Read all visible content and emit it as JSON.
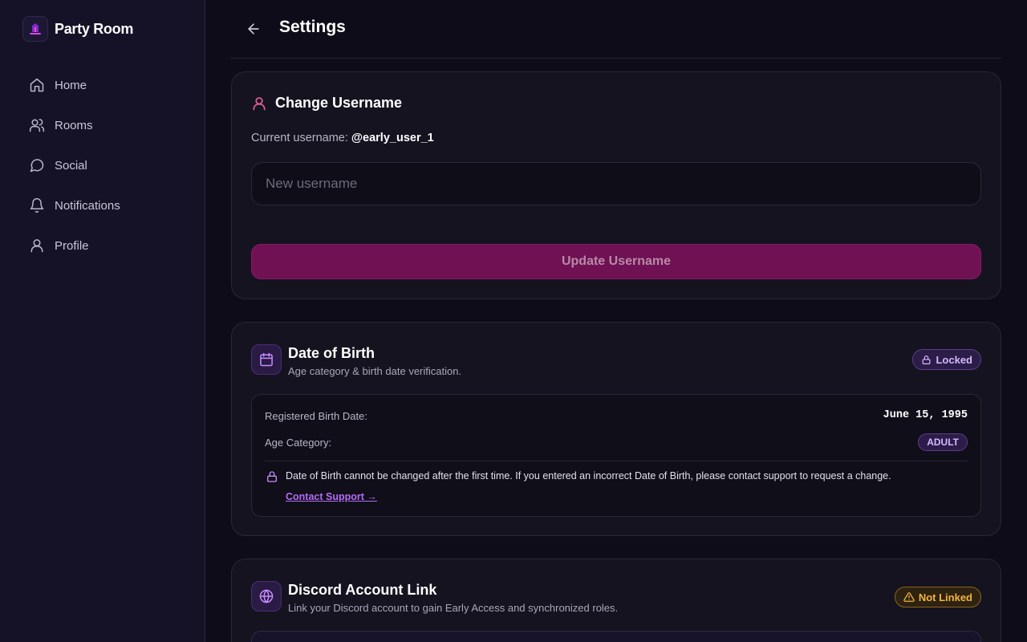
{
  "app": {
    "name": "Party Room"
  },
  "sidebar": {
    "items": [
      {
        "label": "Home",
        "icon": "home-icon"
      },
      {
        "label": "Rooms",
        "icon": "users-icon"
      },
      {
        "label": "Social",
        "icon": "chat-bubble-icon"
      },
      {
        "label": "Notifications",
        "icon": "bell-icon"
      },
      {
        "label": "Profile",
        "icon": "user-icon"
      }
    ]
  },
  "header": {
    "title": "Settings",
    "back_icon": "arrow-left-icon"
  },
  "username_card": {
    "title": "Change Username",
    "current_label": "Current username:",
    "current_value": "@early_user_1",
    "input_placeholder": "New username",
    "input_value": "",
    "button_label": "Update Username"
  },
  "dob_card": {
    "title": "Date of Birth",
    "subtitle": "Age category & birth date verification.",
    "badge": "Locked",
    "birth_date_label": "Registered Birth Date:",
    "birth_date_value": "June 15, 1995",
    "age_category_label": "Age Category:",
    "age_category_value": "ADULT",
    "notice": "Date of Birth cannot be changed after the first time. If you entered an incorrect Date of Birth, please contact support to request a change.",
    "contact_link": "Contact Support →"
  },
  "discord_card": {
    "title": "Discord Account Link",
    "subtitle": "Link your Discord account to gain Early Access and synchronized roles.",
    "badge": "Not Linked"
  },
  "colors": {
    "background": "#0e0c18",
    "sidebar": "#151228",
    "accent_pink": "#e0609a",
    "accent_purple": "#b46cf5",
    "button": "#6f1152",
    "warning": "#f2b440"
  }
}
